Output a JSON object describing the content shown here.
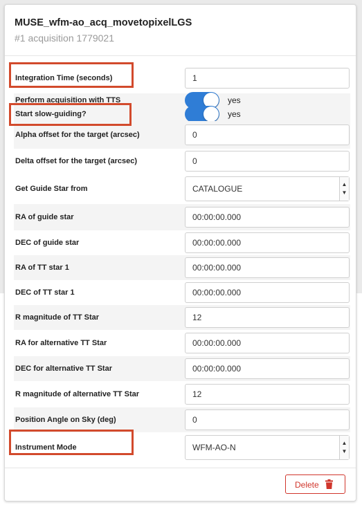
{
  "card": {
    "title": "MUSE_wfm-ao_acq_movetopixelLGS",
    "subtitle": "#1 acquisition 1779021"
  },
  "fields": {
    "integration_time": {
      "label": "Integration Time (seconds)",
      "value": "1"
    },
    "perform_acq_tts": {
      "label": "Perform acquisition with TTS",
      "state": "yes"
    },
    "start_slow_guiding": {
      "label": "Start slow-guiding?",
      "state": "yes"
    },
    "alpha_offset": {
      "label": "Alpha offset for the target (arcsec)",
      "value": "0"
    },
    "delta_offset": {
      "label": "Delta offset for the target (arcsec)",
      "value": "0"
    },
    "guide_star_from": {
      "label": "Get Guide Star from",
      "value": "CATALOGUE"
    },
    "ra_guide": {
      "label": "RA of guide star",
      "value": "00:00:00.000"
    },
    "dec_guide": {
      "label": "DEC of guide star",
      "value": "00:00:00.000"
    },
    "ra_tt1": {
      "label": "RA of TT star 1",
      "value": "00:00:00.000"
    },
    "dec_tt1": {
      "label": "DEC of TT star 1",
      "value": "00:00:00.000"
    },
    "rmag_tt": {
      "label": "R magnitude of TT Star",
      "value": "12"
    },
    "ra_alt_tt": {
      "label": "RA for alternative TT Star",
      "value": "00:00:00.000"
    },
    "dec_alt_tt": {
      "label": "DEC for alternative TT Star",
      "value": "00:00:00.000"
    },
    "rmag_alt_tt": {
      "label": "R magnitude of alternative TT Star",
      "value": "12"
    },
    "position_angle": {
      "label": "Position Angle on Sky (deg)",
      "value": "0"
    },
    "instrument_mode": {
      "label": "Instrument Mode",
      "value": "WFM-AO-N"
    }
  },
  "footer": {
    "delete_label": "Delete"
  },
  "icons": {
    "select_arrow": "updown-arrow-icon",
    "delete": "trash-icon"
  },
  "colors": {
    "toggle_on": "#2f7dd6",
    "highlight": "#d24a2c",
    "danger": "#d0352b"
  }
}
